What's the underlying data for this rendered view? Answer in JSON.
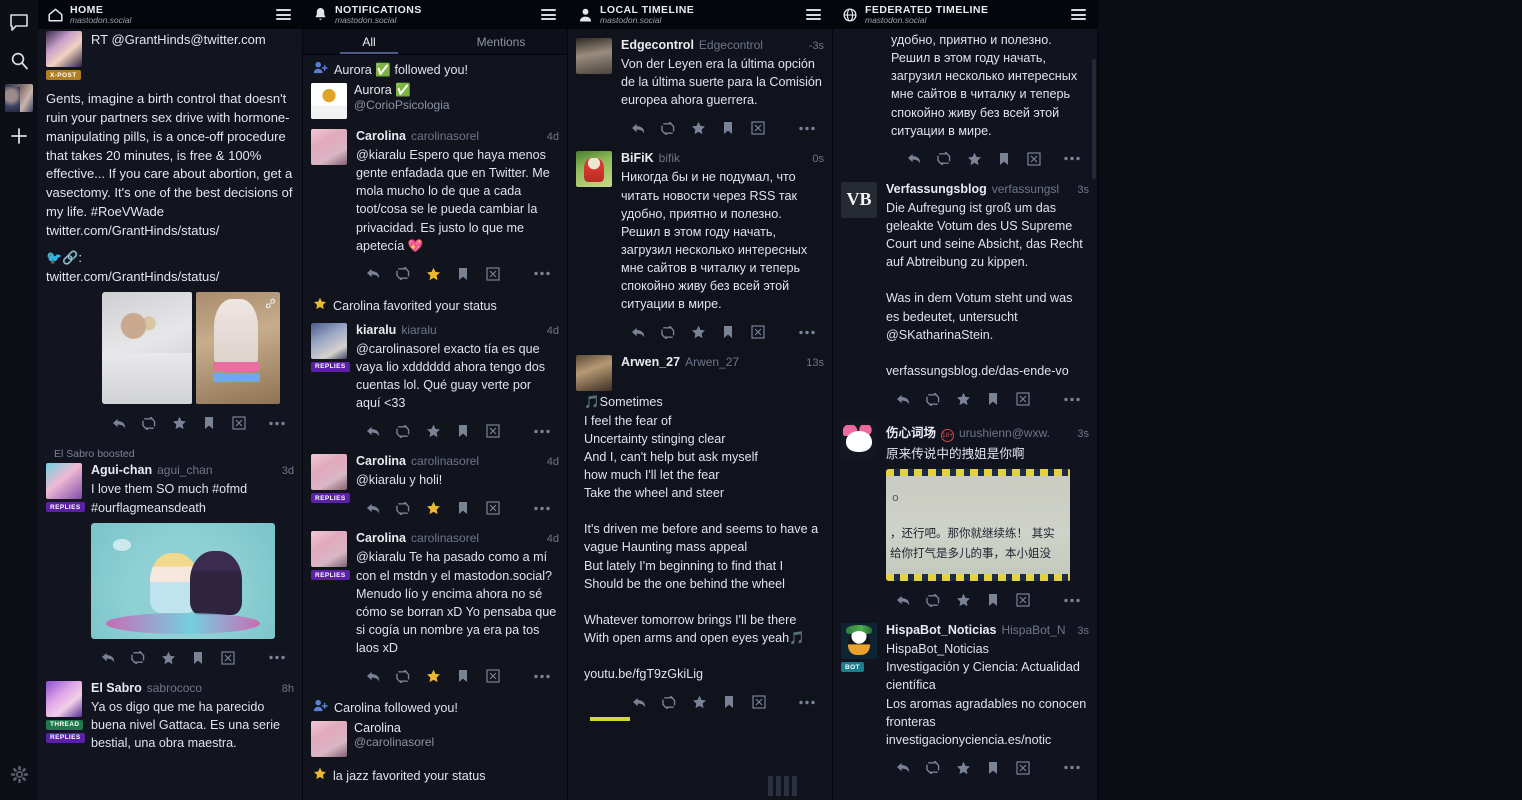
{
  "rail": {
    "items": [
      {
        "name": "compose-icon",
        "label": "Compose"
      },
      {
        "name": "search-icon",
        "label": "Search"
      },
      {
        "name": "account-avatar",
        "label": "Account"
      },
      {
        "name": "add-column-icon",
        "label": "Add column"
      }
    ],
    "bottom": {
      "name": "settings-gear-icon",
      "label": "Settings"
    }
  },
  "columns": [
    {
      "id": "home",
      "title": "HOME",
      "subtitle": "mastodon.social",
      "icon": "home-icon",
      "statuses": [
        {
          "badge": "X-POST",
          "badge_class": "xpost",
          "avatar": "av-anime",
          "header_text": "RT @GrantHinds@twitter.com",
          "text": "Gents, imagine a birth control that doesn't ruin your partners sex drive with hormone-manipulating pills, is a once-off procedure that takes 20 minutes, is free & 100% effective... If you care about abortion, get a vasectomy. It's one of the best decisions of my life. #RoeVWade twitter.com/GrantHinds/status/",
          "link_preface": "🐦🔗:",
          "link": "twitter.com/GrantHinds/status/",
          "media": "two-photos"
        },
        {
          "boost": "El Sabro boosted",
          "avatar": "av-agui",
          "name": "Agui-chan",
          "acct": "agui_chan",
          "time": "3d",
          "badge": "REPLIES",
          "badge_class": "replies",
          "text": "I love them SO much #ofmd #ourflagmeansdeath",
          "media": "ofmd-illustration"
        },
        {
          "avatar": "av-sabro",
          "name": "El Sabro",
          "acct": "sabrococo",
          "time": "8h",
          "badges": [
            "THREAD",
            "REPLIES"
          ],
          "text": "Ya os digo que me ha parecido buena nivel Gattaca. Es una serie bestial, una obra maestra."
        }
      ]
    },
    {
      "id": "notifications",
      "title": "NOTIFICATIONS",
      "subtitle": "mastodon.social",
      "icon": "bell-icon",
      "tabs": [
        {
          "label": "All",
          "active": true
        },
        {
          "label": "Mentions",
          "active": false
        }
      ],
      "items": [
        {
          "kind": "follow",
          "line": "Aurora ✅ followed you!",
          "user_name": "Aurora ✅",
          "user_acct": "@CorioPsicologia",
          "avatar": "av-corio"
        },
        {
          "kind": "status",
          "avatar": "av-carol",
          "name": "Carolina",
          "acct": "carolinasorel",
          "time": "4d",
          "text": "@kiaralu Espero que haya menos gente enfadada que en Twitter. Me mola mucho lo de que a cada toot/cosa se le pueda cambiar la privacidad. Es justo lo que me apetecía 💖",
          "faved": true
        },
        {
          "kind": "fav",
          "line": "Carolina favorited your status"
        },
        {
          "kind": "status",
          "avatar": "av-kiaralu",
          "name": "kiaralu",
          "acct": "kiaralu",
          "time": "4d",
          "badge": "REPLIES",
          "badge_class": "replies",
          "text": "@carolinasorel exacto tía es que vaya lio xdddddd ahora tengo dos cuentas lol. Qué guay verte por aquí <33",
          "faved": false
        },
        {
          "kind": "status",
          "avatar": "av-carol",
          "name": "Carolina",
          "acct": "carolinasorel",
          "time": "4d",
          "badge": "REPLIES",
          "badge_class": "replies",
          "text": "@kiaralu y holi!",
          "faved": true
        },
        {
          "kind": "status",
          "avatar": "av-carol",
          "name": "Carolina",
          "acct": "carolinasorel",
          "time": "4d",
          "badge": "REPLIES",
          "badge_class": "replies",
          "text": "@kiaralu Te ha pasado como a mí con el mstdn y el mastodon.social? Menudo lío y encima ahora no sé cómo se borran xD Yo pensaba que si cogía un nombre ya era pa tos laos xD",
          "faved": true
        },
        {
          "kind": "follow",
          "line": "Carolina followed you!",
          "user_name": "Carolina",
          "user_acct": "@carolinasorel",
          "avatar": "av-carol"
        },
        {
          "kind": "fav",
          "line": "la jazz favorited your status"
        }
      ]
    },
    {
      "id": "local",
      "title": "LOCAL TIMELINE",
      "subtitle": "mastodon.social",
      "icon": "person-icon",
      "statuses": [
        {
          "avatar": "av-edge",
          "name": "Edgecontrol",
          "acct": "Edgecontrol",
          "time": "-3s",
          "text": "Von der Leyen era la última opción de la última suerte para la Comisión europea ahora guerrera."
        },
        {
          "avatar": "av-bifik",
          "name": "BiFiK",
          "acct": "bifik",
          "time": "0s",
          "text": "Никогда бы и не подумал, что читать новости через RSS так удобно, приятно и полезно. Решил в этом году начать, загрузил несколько интересных мне сайтов в читалку и теперь спокойно живу без всей этой ситуации в мире."
        },
        {
          "avatar": "av-arwen",
          "name": "Arwen_27",
          "acct": "Arwen_27",
          "time": "13s",
          "text": "🎵Sometimes\nI feel the fear of\nUncertainty stinging clear\nAnd I, can't help but ask myself\nhow much I'll let the fear\nTake the wheel and steer\n\nIt's driven me before and seems to have a vague Haunting mass appeal\nBut lately I'm beginning to find that I\nShould be the one behind the wheel\n\nWhatever tomorrow brings I'll be there\nWith open arms and open eyes yeah🎵\n\nyoutu.be/fgT9zGkiLig"
        }
      ]
    },
    {
      "id": "federated",
      "title": "FEDERATED TIMELINE",
      "subtitle": "mastodon.social",
      "icon": "globe-icon",
      "statuses": [
        {
          "partial": true,
          "text": "удобно, приятно и полезно.\nРешил в этом году начать, загрузил несколько интересных мне сайтов в читалку и теперь спокойно живу без всей этой ситуации в мире."
        },
        {
          "avatar": "av-vb",
          "avatar_text": "VB",
          "name": "Verfassungsblog",
          "acct": "verfassungsl",
          "time": "3s",
          "text": "Die Aufregung ist groß um das geleakte Votum des US Supreme Court und seine Absicht, das Recht auf Abtreibung zu kippen.\n\nWas in dem Votum steht und was es bedeutet, untersucht @SKatharinaStein.\n\nverfassungsblog.de/das-ende-vo"
        },
        {
          "avatar": "av-cn",
          "name": "伤心词场",
          "age_badge": "18+",
          "acct": "urushienn@wxw.",
          "time": "3s",
          "text": "原来传说中的拽姐是你啊",
          "media": "cn-screenshot",
          "media_lines": [
            "o",
            "，还行吧。那你就继续练！ 其实",
            "给你打气是多儿的事，本小姐没"
          ]
        },
        {
          "avatar": "av-penguin",
          "name": "HispaBot_Noticias",
          "acct": "HispaBot_N",
          "time": "3s",
          "badge": "BOT",
          "badge_class": "bot",
          "text": "HispaBot_Noticias\nInvestigación y Ciencia: Actualidad científica\nLos aromas agradables no conocen fronteras\ninvestigacionyciencia.es/notic"
        }
      ]
    }
  ],
  "action_icons": [
    "reply-icon",
    "boost-icon",
    "favorite-icon",
    "bookmark-icon",
    "dismiss-icon",
    "more-icon"
  ],
  "colors": {
    "accent_star": "#e8b92e",
    "badge_xpost": "#b07d20",
    "badge_replies": "#5b1fa8",
    "badge_thread": "#1e7a4a",
    "badge_bot": "#1b7e8c",
    "verified_green": "#3fba5a",
    "header_bg": "#05060b",
    "column_bg": "#12141f"
  }
}
